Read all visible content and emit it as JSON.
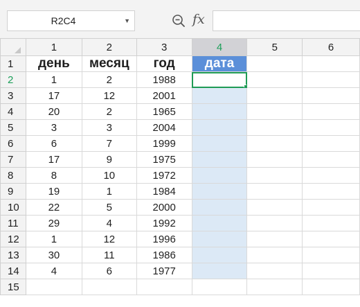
{
  "formula_bar": {
    "name_box": "R2C4",
    "zoom_icon": "zoom-icon",
    "fx_label": "fx",
    "formula_value": ""
  },
  "columns": [
    "1",
    "2",
    "3",
    "4",
    "5",
    "6"
  ],
  "selected_column": "4",
  "selected_row": "2",
  "header_row": {
    "row": "1",
    "cells": [
      "день",
      "месяц",
      "год",
      "дата",
      "",
      ""
    ]
  },
  "rows": [
    {
      "row": "2",
      "cells": [
        "1",
        "2",
        "1988",
        "",
        "",
        ""
      ]
    },
    {
      "row": "3",
      "cells": [
        "17",
        "12",
        "2001",
        "",
        "",
        ""
      ]
    },
    {
      "row": "4",
      "cells": [
        "20",
        "2",
        "1965",
        "",
        "",
        ""
      ]
    },
    {
      "row": "5",
      "cells": [
        "3",
        "3",
        "2004",
        "",
        "",
        ""
      ]
    },
    {
      "row": "6",
      "cells": [
        "6",
        "7",
        "1999",
        "",
        "",
        ""
      ]
    },
    {
      "row": "7",
      "cells": [
        "17",
        "9",
        "1975",
        "",
        "",
        ""
      ]
    },
    {
      "row": "8",
      "cells": [
        "8",
        "10",
        "1972",
        "",
        "",
        ""
      ]
    },
    {
      "row": "9",
      "cells": [
        "19",
        "1",
        "1984",
        "",
        "",
        ""
      ]
    },
    {
      "row": "10",
      "cells": [
        "22",
        "5",
        "2000",
        "",
        "",
        ""
      ]
    },
    {
      "row": "11",
      "cells": [
        "29",
        "4",
        "1992",
        "",
        "",
        ""
      ]
    },
    {
      "row": "12",
      "cells": [
        "1",
        "12",
        "1996",
        "",
        "",
        ""
      ]
    },
    {
      "row": "13",
      "cells": [
        "30",
        "11",
        "1986",
        "",
        "",
        ""
      ]
    },
    {
      "row": "14",
      "cells": [
        "4",
        "6",
        "1977",
        "",
        "",
        ""
      ]
    },
    {
      "row": "15",
      "cells": [
        "",
        "",
        "",
        "",
        "",
        ""
      ]
    }
  ],
  "colors": {
    "accent_green": "#1e9b55",
    "header_fill": "#5b8fd9",
    "column_fill": "#dce9f6"
  }
}
